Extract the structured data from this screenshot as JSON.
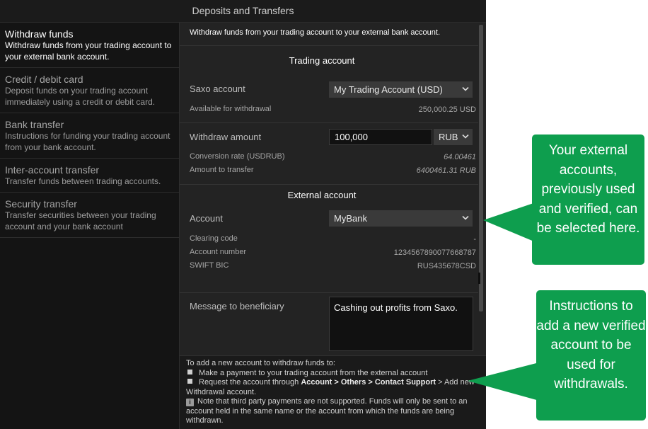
{
  "window": {
    "title": "Deposits and Transfers"
  },
  "sidebar": {
    "items": [
      {
        "title": "Withdraw funds",
        "desc": "Withdraw funds from your trading account to your external bank account."
      },
      {
        "title": "Credit / debit card",
        "desc": "Deposit funds on your trading account immediately using a credit or debit card."
      },
      {
        "title": "Bank transfer",
        "desc": "Instructions for funding your trading account from your bank account."
      },
      {
        "title": "Inter-account transfer",
        "desc": "Transfer funds between trading accounts."
      },
      {
        "title": "Security transfer",
        "desc": "Transfer securities between your trading account and your bank account"
      }
    ]
  },
  "main": {
    "intro": "Withdraw funds from your trading account to your external bank account.",
    "trading": {
      "heading": "Trading account",
      "saxo_label": "Saxo account",
      "saxo_value": "My Trading Account (USD)",
      "available_label": "Available for withdrawal",
      "available_value": "250,000.25 USD",
      "amount_label": "Withdraw amount",
      "amount_value": "100,000",
      "currency": "RUB",
      "conversion_label": "Conversion rate (USDRUB)",
      "conversion_value": "64.00461",
      "transfer_label": "Amount to transfer",
      "transfer_value": "6400461.31 RUB"
    },
    "external": {
      "heading": "External account",
      "account_label": "Account",
      "account_value": "MyBank",
      "clearing_label": "Clearing code",
      "clearing_value": "-",
      "number_label": "Account number",
      "number_value": "1234567890077668787",
      "swift_label": "SWIFT BIC",
      "swift_value": "RUS435678CSD"
    },
    "message": {
      "label": "Message to beneficiary",
      "value": "Cashing out profits from Saxo."
    },
    "footer": {
      "intro": "To add a new account to withdraw funds to:",
      "bullet1": "Make a payment to your trading account from the external account",
      "bullet2_pre": "Request the account through ",
      "bullet2_path": "Account > Others > Contact Support",
      "bullet2_post": " > Add new Withdrawal account.",
      "note": "Note that third party payments are not supported. Funds will only be sent to an account held in the same name or the account from which the funds are being withdrawn."
    }
  },
  "callouts": {
    "top": "Your external accounts, previously used and verified, can be selected here.",
    "bottom": "Instructions to add a new verified account to be used for withdrawals."
  },
  "colors": {
    "callout": "#0e9e4e",
    "background": "#232323",
    "sidebar": "#141414"
  }
}
